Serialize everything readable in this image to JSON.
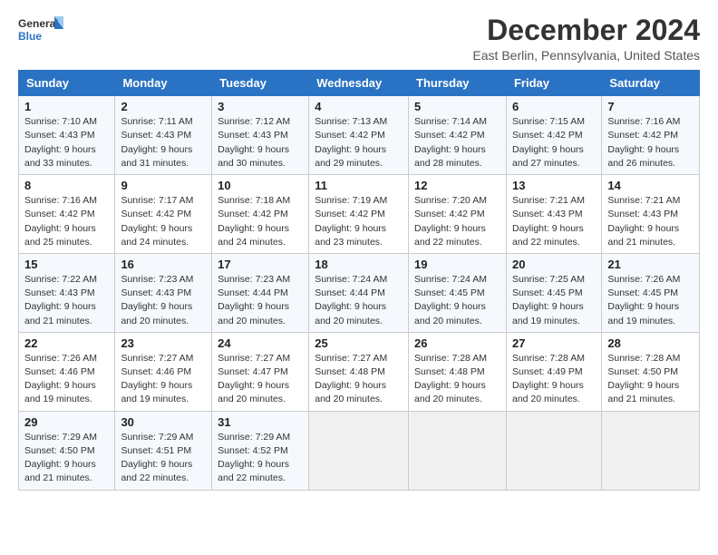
{
  "logo": {
    "line1": "General",
    "line2": "Blue",
    "icon_shape": "triangle_blue"
  },
  "title": "December 2024",
  "subtitle": "East Berlin, Pennsylvania, United States",
  "header": {
    "accent_color": "#2a72c3"
  },
  "days_of_week": [
    "Sunday",
    "Monday",
    "Tuesday",
    "Wednesday",
    "Thursday",
    "Friday",
    "Saturday"
  ],
  "weeks": [
    [
      {
        "day": "1",
        "sunrise": "7:10 AM",
        "sunset": "4:43 PM",
        "daylight": "9 hours and 33 minutes."
      },
      {
        "day": "2",
        "sunrise": "7:11 AM",
        "sunset": "4:43 PM",
        "daylight": "9 hours and 31 minutes."
      },
      {
        "day": "3",
        "sunrise": "7:12 AM",
        "sunset": "4:43 PM",
        "daylight": "9 hours and 30 minutes."
      },
      {
        "day": "4",
        "sunrise": "7:13 AM",
        "sunset": "4:42 PM",
        "daylight": "9 hours and 29 minutes."
      },
      {
        "day": "5",
        "sunrise": "7:14 AM",
        "sunset": "4:42 PM",
        "daylight": "9 hours and 28 minutes."
      },
      {
        "day": "6",
        "sunrise": "7:15 AM",
        "sunset": "4:42 PM",
        "daylight": "9 hours and 27 minutes."
      },
      {
        "day": "7",
        "sunrise": "7:16 AM",
        "sunset": "4:42 PM",
        "daylight": "9 hours and 26 minutes."
      }
    ],
    [
      {
        "day": "8",
        "sunrise": "7:16 AM",
        "sunset": "4:42 PM",
        "daylight": "9 hours and 25 minutes."
      },
      {
        "day": "9",
        "sunrise": "7:17 AM",
        "sunset": "4:42 PM",
        "daylight": "9 hours and 24 minutes."
      },
      {
        "day": "10",
        "sunrise": "7:18 AM",
        "sunset": "4:42 PM",
        "daylight": "9 hours and 24 minutes."
      },
      {
        "day": "11",
        "sunrise": "7:19 AM",
        "sunset": "4:42 PM",
        "daylight": "9 hours and 23 minutes."
      },
      {
        "day": "12",
        "sunrise": "7:20 AM",
        "sunset": "4:42 PM",
        "daylight": "9 hours and 22 minutes."
      },
      {
        "day": "13",
        "sunrise": "7:21 AM",
        "sunset": "4:43 PM",
        "daylight": "9 hours and 22 minutes."
      },
      {
        "day": "14",
        "sunrise": "7:21 AM",
        "sunset": "4:43 PM",
        "daylight": "9 hours and 21 minutes."
      }
    ],
    [
      {
        "day": "15",
        "sunrise": "7:22 AM",
        "sunset": "4:43 PM",
        "daylight": "9 hours and 21 minutes."
      },
      {
        "day": "16",
        "sunrise": "7:23 AM",
        "sunset": "4:43 PM",
        "daylight": "9 hours and 20 minutes."
      },
      {
        "day": "17",
        "sunrise": "7:23 AM",
        "sunset": "4:44 PM",
        "daylight": "9 hours and 20 minutes."
      },
      {
        "day": "18",
        "sunrise": "7:24 AM",
        "sunset": "4:44 PM",
        "daylight": "9 hours and 20 minutes."
      },
      {
        "day": "19",
        "sunrise": "7:24 AM",
        "sunset": "4:45 PM",
        "daylight": "9 hours and 20 minutes."
      },
      {
        "day": "20",
        "sunrise": "7:25 AM",
        "sunset": "4:45 PM",
        "daylight": "9 hours and 19 minutes."
      },
      {
        "day": "21",
        "sunrise": "7:26 AM",
        "sunset": "4:45 PM",
        "daylight": "9 hours and 19 minutes."
      }
    ],
    [
      {
        "day": "22",
        "sunrise": "7:26 AM",
        "sunset": "4:46 PM",
        "daylight": "9 hours and 19 minutes."
      },
      {
        "day": "23",
        "sunrise": "7:27 AM",
        "sunset": "4:46 PM",
        "daylight": "9 hours and 19 minutes."
      },
      {
        "day": "24",
        "sunrise": "7:27 AM",
        "sunset": "4:47 PM",
        "daylight": "9 hours and 20 minutes."
      },
      {
        "day": "25",
        "sunrise": "7:27 AM",
        "sunset": "4:48 PM",
        "daylight": "9 hours and 20 minutes."
      },
      {
        "day": "26",
        "sunrise": "7:28 AM",
        "sunset": "4:48 PM",
        "daylight": "9 hours and 20 minutes."
      },
      {
        "day": "27",
        "sunrise": "7:28 AM",
        "sunset": "4:49 PM",
        "daylight": "9 hours and 20 minutes."
      },
      {
        "day": "28",
        "sunrise": "7:28 AM",
        "sunset": "4:50 PM",
        "daylight": "9 hours and 21 minutes."
      }
    ],
    [
      {
        "day": "29",
        "sunrise": "7:29 AM",
        "sunset": "4:50 PM",
        "daylight": "9 hours and 21 minutes."
      },
      {
        "day": "30",
        "sunrise": "7:29 AM",
        "sunset": "4:51 PM",
        "daylight": "9 hours and 22 minutes."
      },
      {
        "day": "31",
        "sunrise": "7:29 AM",
        "sunset": "4:52 PM",
        "daylight": "9 hours and 22 minutes."
      },
      null,
      null,
      null,
      null
    ]
  ],
  "labels": {
    "sunrise": "Sunrise:",
    "sunset": "Sunset:",
    "daylight": "Daylight:"
  }
}
